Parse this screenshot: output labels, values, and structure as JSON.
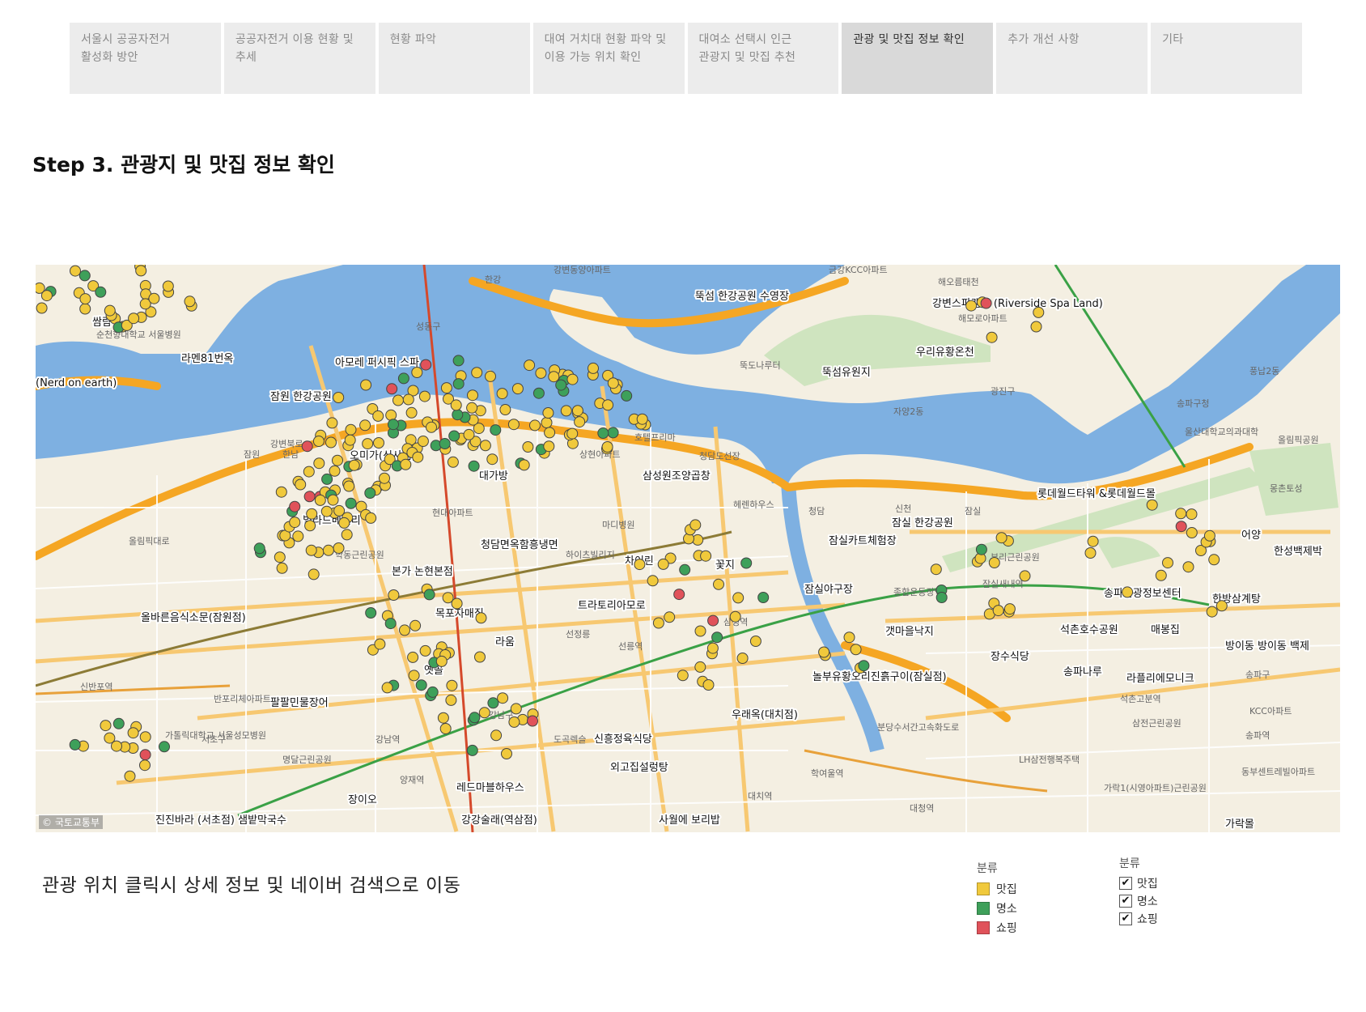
{
  "tabs": [
    {
      "label": "서울시 공공자전거\n활성화 방안",
      "active": false
    },
    {
      "label": "공공자전거 이용 현황 및\n추세",
      "active": false
    },
    {
      "label": "현황 파악",
      "active": false
    },
    {
      "label": "대여 거치대 현황 파악 및\n이용 가능 위치 확인",
      "active": false
    },
    {
      "label": "대여소 선택시 인근\n관광지 및 맛집 추천",
      "active": false
    },
    {
      "label": "관광 및 맛집 정보 확인",
      "active": true
    },
    {
      "label": "추가 개선 사항",
      "active": false
    },
    {
      "label": "기타",
      "active": false
    }
  ],
  "page_title": "Step 3. 관광지 및 맛집 정보 확인",
  "map": {
    "copyright": "© 국토교통부",
    "place_labels": [
      "쌈람",
      "라멘81번옥",
      "(Nerd on earth)",
      "아모레 퍼시픽 스파",
      "잠원 한강공원",
      "오미가(신사점)",
      "대가방",
      "삼성원조양곱창",
      "빌라드베일리",
      "청담면옥함흥냉면",
      "본가 논현본점",
      "차이린",
      "꽃지",
      "목포자매집",
      "트라토리아모로",
      "라움",
      "옛골",
      "팔팔민물장어",
      "올바른음식소문(잠원점)",
      "신흥정육식당",
      "외고집설렁탕",
      "장이오",
      "레드마블하우스",
      "강강술래(역삼점)",
      "사월에 보리밥",
      "우래옥(대치점)",
      "뚝섬 한강공원 수영장",
      "뚝섬유원지",
      "강변스파랜드 (Riverside Spa Land)",
      "우리유황온천",
      "잠실 한강공원",
      "잠실카트체험장",
      "롯데월드타워 &롯데월드몰",
      "송파관광정보센터",
      "석촌호수공원",
      "매봉집",
      "놀부유황오리진흙구이(잠실점)",
      "장수식당",
      "송파나루",
      "라플리에모니크",
      "잠실야구장",
      "갯마을낙지",
      "한방삼계탕",
      "어양",
      "한성백제박",
      "가락몰",
      "방이동 방이동 백제",
      "진진바라 (서초점) 샘밭막국수"
    ],
    "map_labels": [
      "한강",
      "잠원",
      "한남",
      "청담",
      "잠실",
      "신천",
      "헤렌하우스",
      "마디병원",
      "하이츠빌리지",
      "호텔프리마",
      "청담도선장",
      "상현아파트",
      "학동근린공원",
      "현대아파트",
      "강변동양아파트",
      "금강KCC아파트",
      "해오름태천",
      "해모로아파트",
      "광진구",
      "성동구",
      "강남구",
      "서초구",
      "송파구",
      "송파구청",
      "뚝도나루터",
      "자양2동",
      "풍납2동",
      "울산대학교의과대학",
      "올림픽공원",
      "몽촌토성",
      "부리근린공원",
      "잠실새내역",
      "종합운동장역",
      "삼성역",
      "선릉역",
      "선정릉",
      "강남역",
      "양재역",
      "도곡렉슬",
      "대치역",
      "학여울역",
      "대청역",
      "가락1(시영아파트)근린공원",
      "석촌고분역",
      "삼전근린공원",
      "LH삼전행복주택",
      "KCC아파트",
      "송파역",
      "동부센트레빌아파트",
      "반포리체아파트",
      "신반포역",
      "가톨릭대학교 서울성모병원",
      "명달근린공원",
      "순천향대학교 서울병원",
      "강변북로",
      "올림픽대로",
      "분당수서간고속화도로"
    ]
  },
  "caption": "관광 위치 클릭시 상세 정보 및 네이버 검색으로 이동",
  "legend": {
    "title": "분류",
    "items": [
      {
        "label": "맛집",
        "color": "#f0c93c"
      },
      {
        "label": "명소",
        "color": "#3ea05a"
      },
      {
        "label": "쇼핑",
        "color": "#e0525a"
      }
    ]
  },
  "filter": {
    "title": "분류",
    "items": [
      {
        "label": "맛집",
        "checked": true
      },
      {
        "label": "명소",
        "checked": true
      },
      {
        "label": "쇼핑",
        "checked": true
      }
    ]
  },
  "colors": {
    "water": "#7eb0e1",
    "land": "#f4efe2",
    "park": "#cfe4bf",
    "highway": "#f5a623",
    "road": "#ffffff"
  }
}
